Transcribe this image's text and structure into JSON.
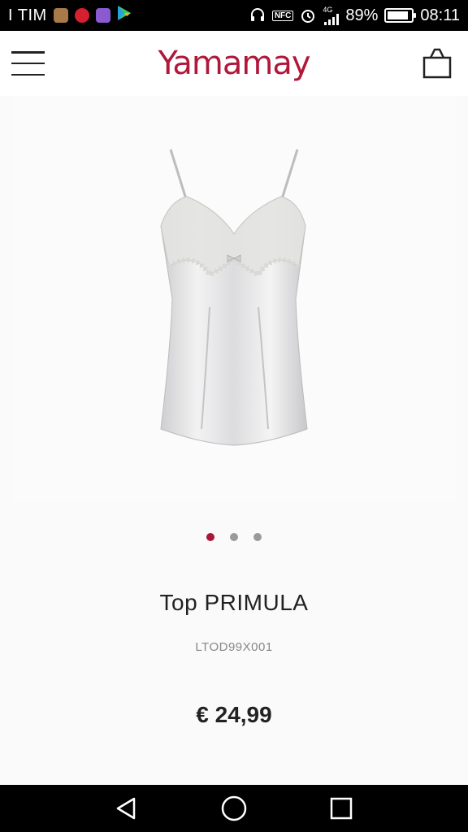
{
  "status_bar": {
    "carrier": "I TIM",
    "network": "4G",
    "battery_percent": "89%",
    "battery_level": 0.89,
    "time": "08:11",
    "icons": [
      "app-icon",
      "pinterest-icon",
      "gallery-app-icon",
      "play-store-icon",
      "headphones-icon",
      "nfc-icon",
      "alarm-icon",
      "signal-icon",
      "battery-icon"
    ],
    "nfc_label": "NFC"
  },
  "header": {
    "logo_text": "Yamamay",
    "brand_color": "#b0183a",
    "menu_icon": "hamburger-menu-icon",
    "bag_icon": "shopping-bag-icon"
  },
  "product": {
    "image_alt": "satin camisole with lace trim",
    "name": "Top PRIMULA",
    "code": "LTOD99X001",
    "price": "€ 24,99"
  },
  "carousel": {
    "total": 3,
    "active_index": 0,
    "active_color": "#a8183a"
  },
  "nav": {
    "icons": [
      "back-icon",
      "home-icon",
      "recents-icon"
    ]
  }
}
